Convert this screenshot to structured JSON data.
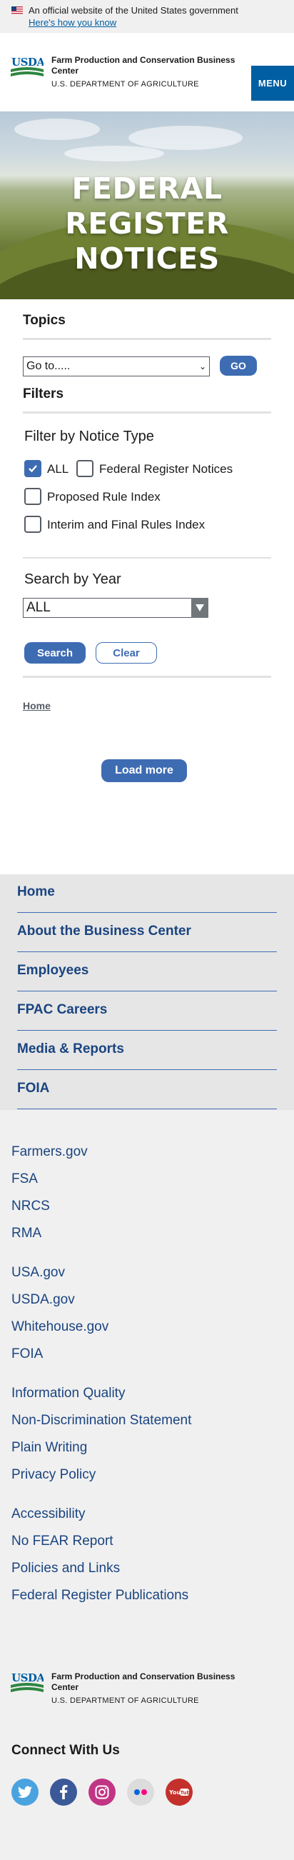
{
  "gov_banner": {
    "official_text": "An official website of the United States government",
    "how_know": "Here's how you know"
  },
  "header": {
    "agency_name": "Farm Production and Conservation Business Center",
    "department": "U.S. DEPARTMENT OF AGRICULTURE",
    "menu_label": "MENU"
  },
  "hero": {
    "title_line1": "FEDERAL REGISTER",
    "title_line2": "NOTICES"
  },
  "topics": {
    "heading": "Topics",
    "select_value": "Go to.....",
    "go_label": "GO"
  },
  "filters": {
    "heading": "Filters",
    "notice_type_label": "Filter by Notice Type",
    "options": [
      {
        "label": "ALL",
        "checked": true
      },
      {
        "label": "Federal Register Notices",
        "checked": false
      },
      {
        "label": "Proposed Rule Index",
        "checked": false
      },
      {
        "label": "Interim and Final Rules Index",
        "checked": false
      }
    ],
    "year_label": "Search by Year",
    "year_value": "ALL",
    "search_label": "Search",
    "clear_label": "Clear"
  },
  "breadcrumb": {
    "home": "Home"
  },
  "load_more_label": "Load more",
  "footer_nav": [
    "Home",
    "About the Business Center",
    "Employees",
    "FPAC Careers",
    "Media & Reports",
    "FOIA"
  ],
  "footer_links": {
    "group1": [
      "Farmers.gov",
      "FSA",
      "NRCS",
      "RMA"
    ],
    "group2": [
      "USA.gov",
      "USDA.gov",
      "Whitehouse.gov",
      "FOIA"
    ],
    "group3": [
      "Information Quality",
      "Non-Discrimination Statement",
      "Plain Writing",
      "Privacy Policy"
    ],
    "group4": [
      "Accessibility",
      "No FEAR Report",
      "Policies and Links",
      "Federal Register Publications"
    ]
  },
  "footer_brand": {
    "agency_name": "Farm Production and Conservation Business Center",
    "department": "U.S. DEPARTMENT OF AGRICULTURE",
    "logo_text": "USDA"
  },
  "connect": {
    "heading": "Connect With Us",
    "icons": [
      "twitter-icon",
      "facebook-icon",
      "instagram-icon",
      "flickr-icon",
      "youtube-icon"
    ]
  },
  "colors": {
    "primary": "#3e6cb3",
    "nav_text": "#1a4480",
    "menu_bg": "#005ea2",
    "usda_green": "#2e8540",
    "twitter": "#4aa3df",
    "facebook": "#3b5998",
    "instagram": "#c13584",
    "flickr_bg": "#dcdcdc",
    "youtube": "#c4302b"
  }
}
